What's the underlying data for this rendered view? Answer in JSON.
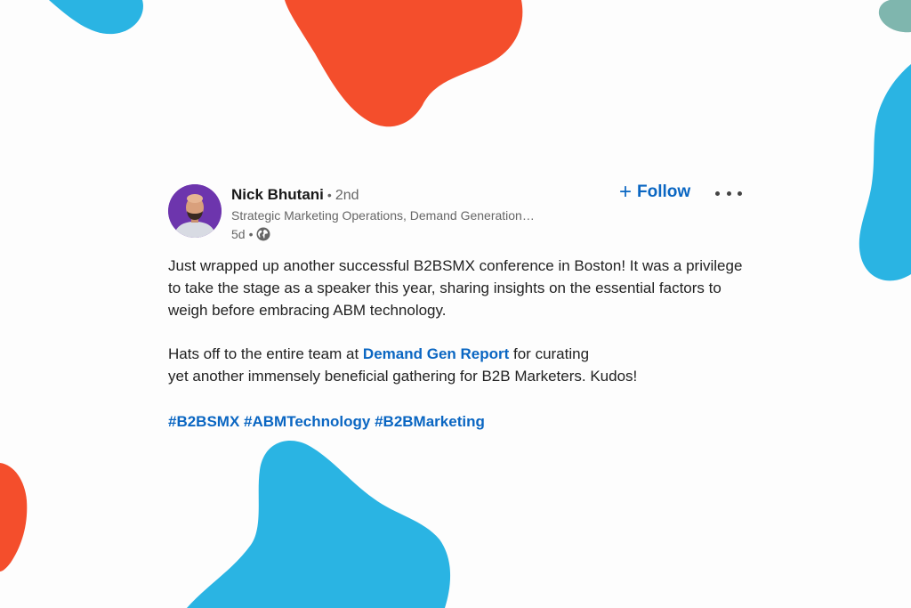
{
  "colors": {
    "blob_blue": "#2ab4e3",
    "blob_red": "#f44e2c",
    "blob_teal": "#7fb6ae",
    "link_blue": "#0a66c2"
  },
  "post": {
    "author": {
      "name": "Nick Bhutani",
      "degree": "2nd",
      "headline": "Strategic Marketing Operations, Demand Generation…",
      "time": "5d",
      "visibility_icon": "globe-icon"
    },
    "follow_label": "Follow",
    "more_icon": "ellipsis-icon",
    "body": {
      "p1": "Just wrapped up another successful B2BSMX conference in Boston! It was a privilege to take the stage as a speaker this year, sharing insights on the essential factors to weigh before embracing ABM technology.",
      "p2_before": "Hats off to the entire team at ",
      "p2_mention": "Demand Gen Report",
      "p2_after_line1": " for curating",
      "p2_line2": "yet another immensely beneficial gathering for B2B Marketers. Kudos!",
      "hashtags": [
        "#B2BSMX",
        "#ABMTechnology",
        "#B2BMarketing"
      ]
    }
  }
}
